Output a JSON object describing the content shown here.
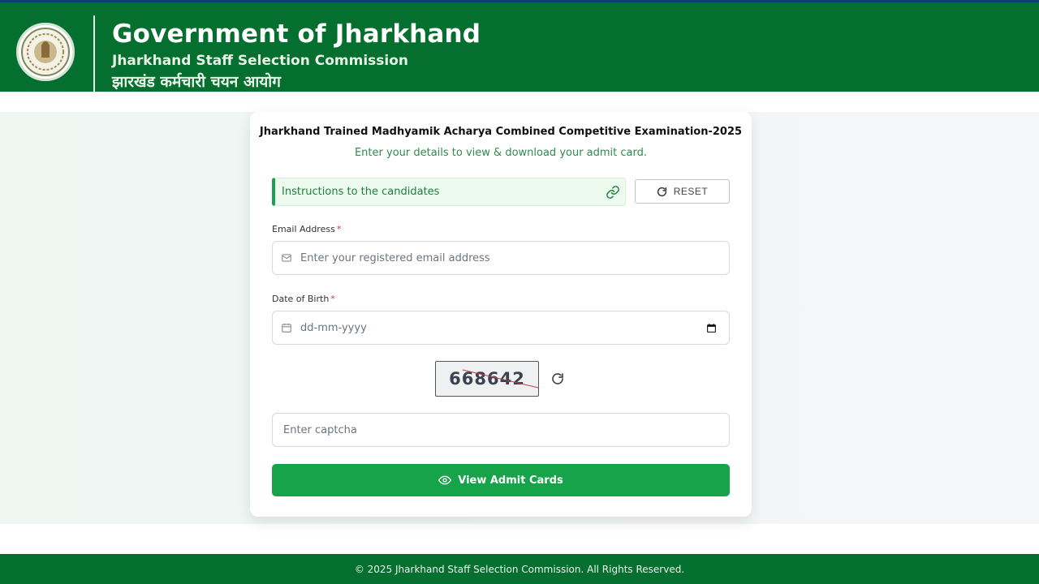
{
  "header": {
    "title": "Government of Jharkhand",
    "subtitle": "Jharkhand Staff Selection Commission",
    "subtitle_hindi": "झारखंड कर्मचारी चयन आयोग",
    "logo_icon": "state-emblem-icon"
  },
  "form": {
    "exam_title": "Jharkhand Trained Madhyamik Acharya Combined Competitive Examination-2025",
    "exam_subtitle": "Enter your details to view & download your admit card.",
    "instructions_label": "Instructions to the candidates",
    "instructions_icon": "link-icon",
    "reset_label": "RESET",
    "reset_icon": "refresh-icon",
    "email": {
      "label": "Email Address",
      "required_mark": "*",
      "placeholder": "Enter your registered email address",
      "icon": "mail-icon"
    },
    "dob": {
      "label": "Date of Birth",
      "required_mark": "*",
      "placeholder": "dd-mm-yyyy",
      "icon": "calendar-icon"
    },
    "captcha": {
      "code": "668642",
      "input_placeholder": "Enter captcha",
      "refresh_icon": "refresh-icon"
    },
    "submit_label": "View Admit Cards",
    "submit_icon": "eye-icon"
  },
  "footer": {
    "text": "© 2025 Jharkhand Staff Selection Commission. All Rights Reserved."
  },
  "colors": {
    "header_green": "#046f2f",
    "primary_button": "#16a34a",
    "accent_text": "#2e8a4f",
    "required": "#dd3333"
  }
}
